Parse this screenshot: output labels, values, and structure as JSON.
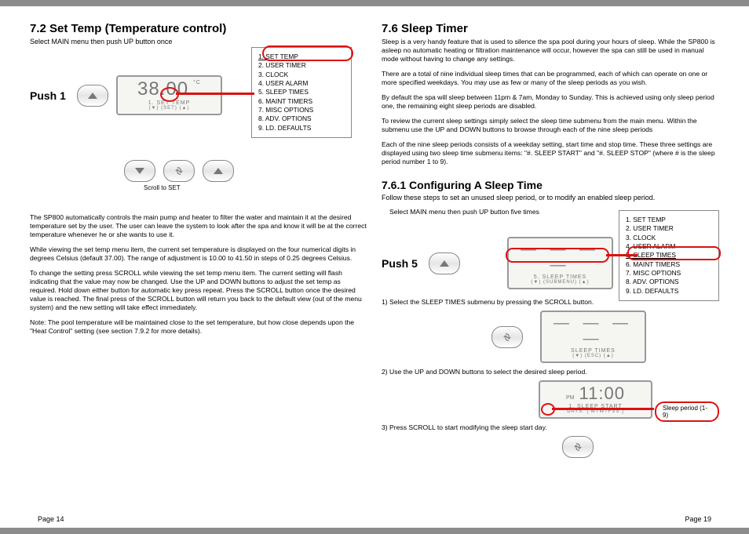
{
  "left": {
    "heading": "7.2 Set Temp (Temperature control)",
    "subhead": "Select MAIN menu then push UP button once",
    "push1": "Push 1",
    "lcd_big": "38.00",
    "lcd_unit": "°C",
    "lcd_line2": "1.  SET  TEMP",
    "lcd_line3": "(▼)        (SET)      (▲)",
    "scroll_caption": "Scroll to SET",
    "menu": [
      "1. SET TEMP",
      "2. USER TIMER",
      "3. CLOCK",
      "4. USER ALARM",
      "5. SLEEP TIMES",
      "6. MAINT TIMERS",
      "7. MISC OPTIONS",
      "8. ADV. OPTIONS",
      "9. LD. DEFAULTS"
    ],
    "menu_pick_index": 0,
    "p1": "The SP800 automatically controls the main pump and heater to filter the water and maintain it at the desired temperature  set by the user. The user can leave the system to look after the spa and know it will be at the correct temperature whenever he or she wants to use it.",
    "p2": "While viewing the set temp menu item, the current set temperature is displayed on the four numerical digits in degrees Celsius (default 37.00).  The range of adjustment is 10.00 to 41.50 in steps of 0.25 degrees Celsius.",
    "p3": "To change the setting press SCROLL while viewing the set temp menu item.  The current setting will flash indicating that the value may now be changed.  Use the UP and DOWN buttons to adjust the set temp as required.  Hold down either button for automatic key press repeat.  Press the SCROLL button once the desired value is reached.  The final press of the SCROLL button will return you back to the default view (out of the menu system) and the new setting will take effect immediately.",
    "p4": "Note:  The pool temperature will be maintained close to the set temperature, but how close depends upon the \"Heat Control\" setting (see section 7.9.2 for more details)."
  },
  "right": {
    "h1": "7.6 Sleep Timer",
    "p1": "Sleep is a very handy feature that is used to silence the spa pool during your hours of sleep.  While the SP800 is asleep no automatic heating or filtration maintenance will occur, however the spa can still be used in manual mode without having to change any settings.",
    "p2": "There are a total of nine individual sleep times that can be programmed, each of which can operate on one or more specified weekdays.  You may use as few or many of the sleep periods as you wish.",
    "p3": "By default the spa will sleep between 11pm & 7am, Monday to Sunday.  This is achieved using only sleep period one, the remaining eight sleep periods are disabled.",
    "p4": "To review the current sleep settings simply select the sleep time submenu from the main menu.  Within the submenu use the UP and DOWN buttons to browse through each of the nine sleep periods",
    "p5": "Each of the nine sleep periods consists of a weekday setting, start time and stop time.  These three settings are displayed using two sleep time submenu items: \"#. SLEEP START\" and \"#. SLEEP STOP\" (where # is the sleep period number 1 to 9).",
    "h2": "7.6.1 Configuring A Sleep Time",
    "sub2": "Follow these steps to set an unused sleep period, or to modify an enabled sleep period.",
    "step_intro": "Select MAIN menu then push UP button five times",
    "push5": "Push 5",
    "lcd1_line2": "5.  SLEEP  TIMES",
    "lcd1_line3": "(▼)   (SUBMENU)  (▲)",
    "dashes": "— — — —",
    "menu": [
      "1. SET TEMP",
      "2. USER TIMER",
      "3. CLOCK",
      "4. USER ALARM",
      "5. SLEEP TIMES",
      "6. MAINT TIMERS",
      "7. MISC OPTIONS",
      "8. ADV. OPTIONS",
      "9. LD. DEFAULTS"
    ],
    "menu_pick_index": 4,
    "step1": "1)   Select  the SLEEP TIMES submenu by pressing the SCROLL button.",
    "lcd2_line2": "SLEEP  TIMES",
    "lcd2_line3": "(▼)     (ESC)     (▲)",
    "step2": "2)   Use the UP and DOWN buttons to select the desired sleep period.",
    "lcd3_big": "11:00",
    "lcd3_pm": "PM",
    "lcd3_line2": "1.  SLEEP  START",
    "lcd3_line3": "DAYS:     [ MTWTFSS ]",
    "callout": "Sleep period (1-9)",
    "step3": "3)   Press SCROLL to start modifying the sleep start day."
  },
  "page_left": "Page 14",
  "page_right": "Page 19"
}
